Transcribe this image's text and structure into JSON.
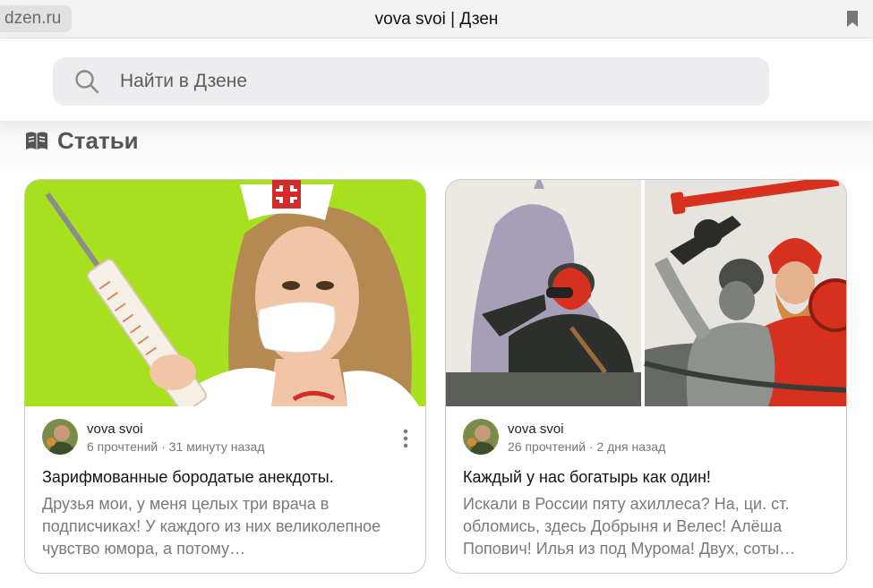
{
  "browser": {
    "domain": "dzen.ru",
    "title": "vova svoi | Дзен",
    "bookmark_icon": "bookmark-icon"
  },
  "search": {
    "placeholder": "Найти в Дзене",
    "icon": "search-icon"
  },
  "section": {
    "title": "Статьи",
    "icon": "articles-icon"
  },
  "articles": [
    {
      "author": "vova svoi",
      "meta": "6 прочтений · 31 минуту назад",
      "title": "Зарифмованные бородатые анекдоты.",
      "snippet": "Друзья мои, у меня целых три врача в подписчиках! У каждого из них великолепное чувство юмора, а потому…",
      "has_menu": true
    },
    {
      "author": "vova svoi",
      "meta": "26 прочтений · 2 дня назад",
      "title": "Каждый у нас богатырь как один!",
      "snippet": "Искали в России пяту ахиллеса? На, ци. ст. обломись, здесь Добрыня и Велес! Алёша Попович! Илья из под Мурома! Двух, соты…",
      "has_menu": false
    }
  ],
  "colors": {
    "thumb1_bg": "#a6e01f",
    "search_bg": "#ededf0",
    "poster_red": "#d8301e"
  }
}
